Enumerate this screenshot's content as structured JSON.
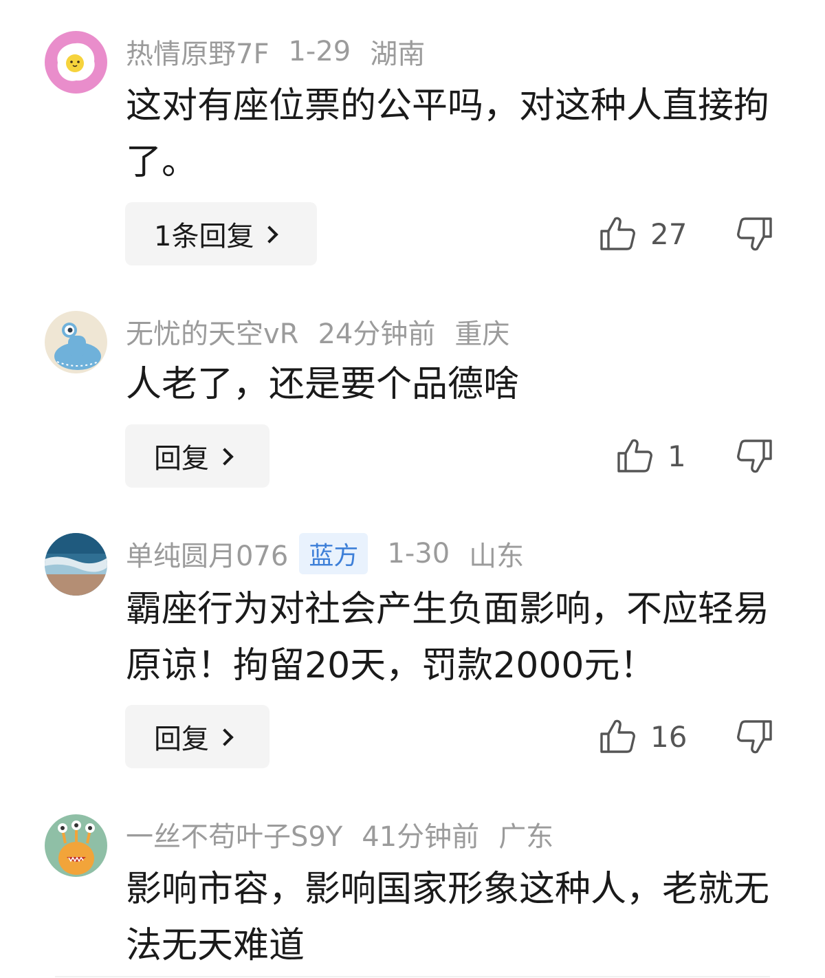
{
  "comments": [
    {
      "username": "热情原野7F",
      "badge": "",
      "date": "1-29",
      "location": "湖南",
      "text": "这对有座位票的公平吗，对这种人直接拘了。",
      "reply_label": "1条回复",
      "likes": "27",
      "avatar": "fried-egg-avatar"
    },
    {
      "username": "无忧的天空vR",
      "badge": "",
      "date": "24分钟前",
      "location": "重庆",
      "text": "人老了，还是要个品德啥",
      "reply_label": "回复",
      "likes": "1",
      "avatar": "blue-alien-avatar"
    },
    {
      "username": "单纯圆月076",
      "badge": "蓝方",
      "date": "1-30",
      "location": "山东",
      "text": "霸座行为对社会产生负面影响，不应轻易原谅！拘留20天，罚款2000元！",
      "reply_label": "回复",
      "likes": "16",
      "avatar": "beach-wave-avatar"
    },
    {
      "username": "一丝不苟叶子S9Y",
      "badge": "",
      "date": "41分钟前",
      "location": "广东",
      "text": "影响市容，影响国家形象这种人，老就无法无天难道",
      "reply_label": "",
      "likes": "",
      "avatar": "orange-monster-avatar"
    }
  ],
  "icons": {
    "like": "thumbs-up-icon",
    "dislike": "thumbs-down-icon",
    "reply_arrow": "chevron-right-icon"
  },
  "colors": {
    "meta_text": "#9b9b9b",
    "body_text": "#1a1a1a",
    "reply_bg": "#f4f4f4",
    "badge_bg": "#e9f2fd",
    "badge_text": "#3d7fd8"
  }
}
